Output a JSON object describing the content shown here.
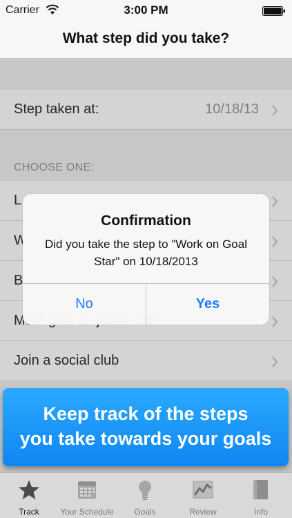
{
  "status_bar": {
    "carrier": "Carrier",
    "time": "3:00 PM"
  },
  "nav": {
    "title": "What step did you take?"
  },
  "step_taken": {
    "label": "Step taken at:",
    "value": "10/18/13"
  },
  "section": {
    "header": "CHOOSE ONE:"
  },
  "options": [
    {
      "label": "L"
    },
    {
      "label": "W"
    },
    {
      "label": "B"
    },
    {
      "label": "Meet girls on jDate.com"
    },
    {
      "label": "Join a social club"
    }
  ],
  "alert": {
    "title": "Confirmation",
    "message": "Did you take the step to \"Work on Goal Star\" on 10/18/2013",
    "no_label": "No",
    "yes_label": "Yes"
  },
  "promo": {
    "line1": "Keep track of the steps",
    "line2": "you take towards your goals"
  },
  "tabs": [
    {
      "label": "Track",
      "icon": "star-icon"
    },
    {
      "label": "Your Schedule",
      "icon": "calendar-icon"
    },
    {
      "label": "Goals",
      "icon": "lightbulb-icon"
    },
    {
      "label": "Review",
      "icon": "chart-icon"
    },
    {
      "label": "Info",
      "icon": "book-icon"
    }
  ],
  "colors": {
    "accent": "#1a7cf6",
    "banner": "#1a96f8"
  }
}
